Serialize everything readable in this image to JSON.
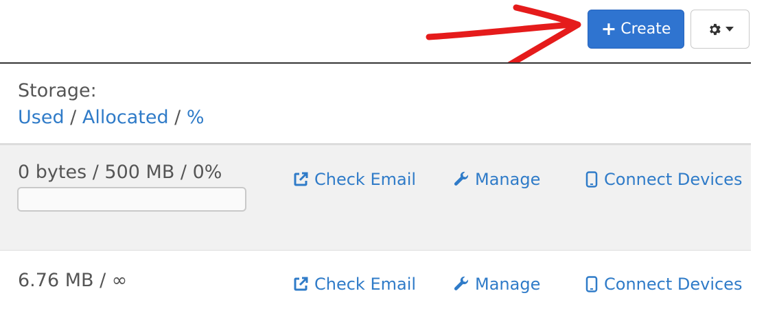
{
  "toolbar": {
    "create_label": "Create",
    "create_icon": "plus-icon",
    "settings_icon": "gear-icon",
    "accent": "#2f74d0"
  },
  "annotation": {
    "color": "#e51b1b",
    "icon": "red-arrow-annotation"
  },
  "header": {
    "storage_label": "Storage:",
    "used": "Used",
    "allocated": "Allocated",
    "percent": "%",
    "separator": " / "
  },
  "rows": [
    {
      "usage": "0 bytes / 500 MB / 0%",
      "progress": 0,
      "check_email": "Check Email",
      "manage": "Manage",
      "connect_devices": "Connect Devices"
    },
    {
      "usage": "6.76 MB / ∞",
      "check_email": "Check Email",
      "manage": "Manage",
      "connect_devices": "Connect Devices"
    }
  ]
}
